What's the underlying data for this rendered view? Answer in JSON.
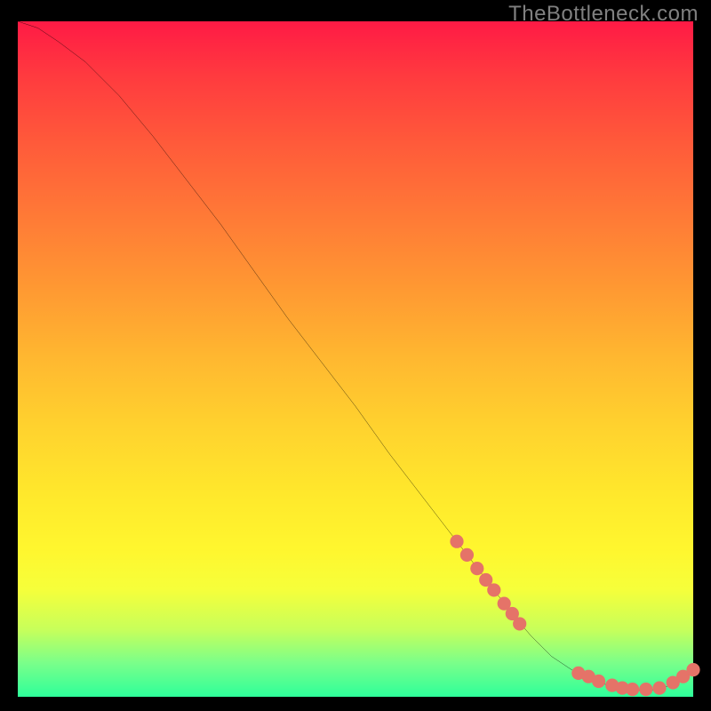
{
  "watermark": "TheBottleneck.com",
  "chart_data": {
    "type": "line",
    "title": "",
    "xlabel": "",
    "ylabel": "",
    "xlim": [
      0,
      100
    ],
    "ylim": [
      0,
      100
    ],
    "curve": {
      "name": "bottleneck-curve",
      "x": [
        0,
        3,
        6,
        10,
        15,
        20,
        25,
        30,
        35,
        40,
        45,
        50,
        55,
        60,
        65,
        70,
        73,
        76,
        79,
        82,
        85,
        88,
        91,
        94,
        96,
        98,
        100
      ],
      "y": [
        100,
        99,
        97,
        94,
        89,
        83,
        76.5,
        70,
        63,
        56,
        49.5,
        43,
        36,
        29.5,
        23,
        16.5,
        12.5,
        9,
        6,
        4,
        2.5,
        1.5,
        1,
        1,
        1.5,
        2.5,
        4
      ]
    },
    "dotted_segments": [
      {
        "name": "upper-dotted",
        "points": [
          {
            "x": 65,
            "y": 23
          },
          {
            "x": 66.5,
            "y": 21
          },
          {
            "x": 68,
            "y": 19
          },
          {
            "x": 69.3,
            "y": 17.3
          },
          {
            "x": 70.5,
            "y": 15.8
          },
          {
            "x": 72,
            "y": 13.8
          },
          {
            "x": 73.2,
            "y": 12.3
          },
          {
            "x": 74.3,
            "y": 10.8
          }
        ]
      },
      {
        "name": "lower-dotted",
        "points": [
          {
            "x": 83,
            "y": 3.5
          },
          {
            "x": 84.5,
            "y": 3
          },
          {
            "x": 86,
            "y": 2.3
          },
          {
            "x": 88,
            "y": 1.7
          },
          {
            "x": 89.5,
            "y": 1.3
          },
          {
            "x": 91,
            "y": 1.1
          },
          {
            "x": 93,
            "y": 1.1
          },
          {
            "x": 95,
            "y": 1.3
          },
          {
            "x": 97,
            "y": 2.1
          },
          {
            "x": 98.5,
            "y": 3
          },
          {
            "x": 100,
            "y": 4
          }
        ]
      }
    ],
    "colors": {
      "curve_stroke": "#000000",
      "dot_fill": "#e57368",
      "gradient_top": "#ff1a45",
      "gradient_bottom": "#2eff9a"
    }
  }
}
